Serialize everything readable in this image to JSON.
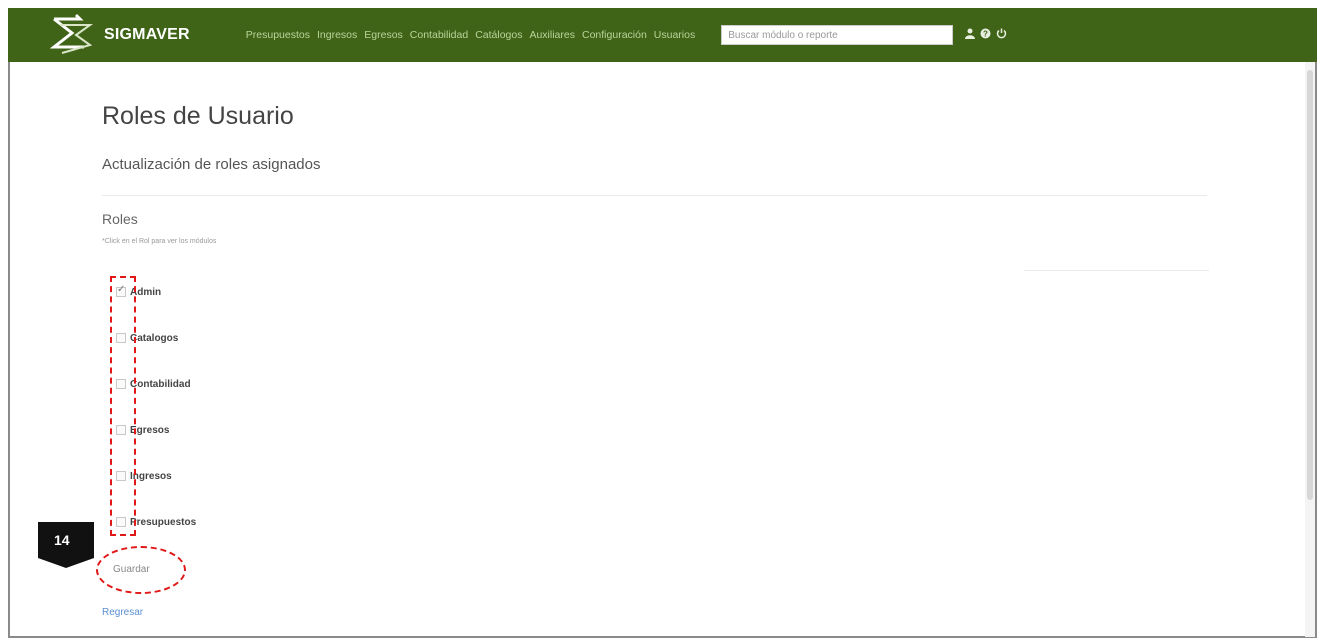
{
  "navbar": {
    "brand": "SIGMAVER",
    "menu": [
      "Presupuestos",
      "Ingresos",
      "Egresos",
      "Contabilidad",
      "Catálogos",
      "Auxiliares",
      "Configuración",
      "Usuarios"
    ],
    "search_placeholder": "Buscar módulo o reporte",
    "icons": [
      "user-icon",
      "help-icon",
      "logout-icon"
    ]
  },
  "page": {
    "title": "Roles de Usuario",
    "subtitle": "Actualización de roles asignados",
    "roles_heading": "Roles",
    "roles_hint": "*Click en el Rol para ver los módulos"
  },
  "roles": [
    {
      "label": "Admin",
      "checked": true
    },
    {
      "label": "Catalogos",
      "checked": false
    },
    {
      "label": "Contabilidad",
      "checked": false
    },
    {
      "label": "Egresos",
      "checked": false
    },
    {
      "label": "Ingresos",
      "checked": false
    },
    {
      "label": "Presupuestos",
      "checked": false
    }
  ],
  "actions": {
    "save_label": "Guardar",
    "back_label": "Regresar"
  },
  "annotation": {
    "step_number": "14",
    "color": "#e01818"
  },
  "colors": {
    "navbar_bg": "#3f6418",
    "menu_text": "#b9d49a",
    "link": "#5b8fd1"
  }
}
